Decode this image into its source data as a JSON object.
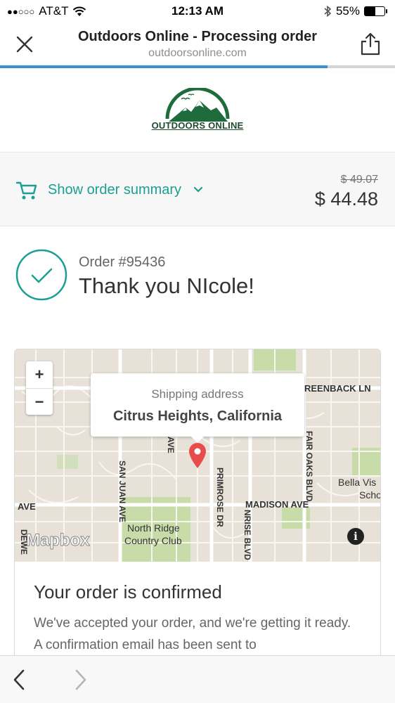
{
  "status_bar": {
    "carrier": "AT&T",
    "signal": "●●○○○",
    "time": "12:13 AM",
    "battery": "55%",
    "battery_level": 0.55
  },
  "nav": {
    "title": "Outdoors Online - Processing order",
    "url": "outdoorsonline.com",
    "page_load_progress": 0.83
  },
  "brand": {
    "logo_text": "OUTDOORS ONLINE",
    "color": "#1e6b3c"
  },
  "summary": {
    "label": "Show order summary",
    "original_price": "$ 49.07",
    "total_price": "$ 44.48",
    "accent": "#1aa093"
  },
  "order": {
    "number": "Order #95436",
    "thanks": "Thank you NIcole!"
  },
  "map": {
    "zoom_in": "+",
    "zoom_out": "−",
    "popup_label": "Shipping address",
    "popup_address": "Citrus Heights, California",
    "attribution_logo": "Mapbox",
    "info": "i",
    "labels": {
      "greenback": "REENBACK LN",
      "fair_oaks": "FAIR OAKS BLVD",
      "san_juan": "SAN JUAN AVE",
      "primrose": "PRIMROSE DR",
      "sunrise": "NRISE BLVD",
      "madison": "MADISON AVE",
      "ave_left": "AVE",
      "ave_top": "AVE",
      "dewey": "DEWE",
      "north_ridge_1": "North Ridge",
      "north_ridge_2": "Country Club",
      "bella_1": "Bella Vis",
      "bella_2": "Scho"
    }
  },
  "confirmation": {
    "title": "Your order is confirmed",
    "body": "We've accepted your order, and we're getting it ready. A confirmation email has been sent to"
  },
  "toolbar": {
    "back_icon": "chevron-left-icon",
    "forward_icon": "chevron-right-icon"
  }
}
